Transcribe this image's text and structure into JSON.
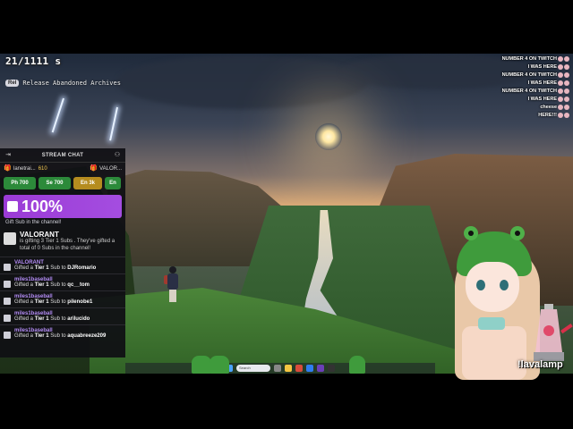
{
  "overlay": {
    "sub_count": "21/1111 s",
    "release_badge": "Rel",
    "release_text": "Release Abandoned Archives"
  },
  "chat": {
    "title": "STREAM CHAT",
    "hype_user": "lanetrai...",
    "hype_count": "610",
    "hype_game": "VALOR...",
    "predictions": [
      "Ph 700",
      "Se 700",
      "En 3k",
      "En"
    ],
    "hype_percent": "100%",
    "hype_note": "Gift Sub in the channel!",
    "gift_main": {
      "name": "VALORANT",
      "text": "is gifting 3 Tier 1 Subs . They've gifted a total of 0 Subs in the channel!"
    },
    "gifts": [
      {
        "user": "VALORANT",
        "prefix": "Gifted a",
        "tier": "Tier 1",
        "mid": "Sub to",
        "recipient": "DJRomario"
      },
      {
        "user": "miles1baseball",
        "prefix": "Gifted a",
        "tier": "Tier 1",
        "mid": "Sub to",
        "recipient": "qc__tom"
      },
      {
        "user": "miles1baseball",
        "prefix": "Gifted a",
        "tier": "Tier 1",
        "mid": "Sub to",
        "recipient": "pilenobe1"
      },
      {
        "user": "miles1baseball",
        "prefix": "Gifted a",
        "tier": "Tier 1",
        "mid": "Sub to",
        "recipient": "arilucido"
      },
      {
        "user": "miles1baseball",
        "prefix": "Gifted a",
        "tier": "Tier 1",
        "mid": "Sub to",
        "recipient": "aquabreeze209"
      }
    ]
  },
  "ticker": [
    "NUMBER 4 ON TWITCH",
    "I WAS HERE",
    "NUMBER 4 ON TWITCH",
    "I WAS HERE",
    "NUMBER 4 ON TWITCH",
    "I WAS HERE",
    "cheese",
    "HERE!!!"
  ],
  "lava_label": "!lavalamp",
  "taskbar": {
    "search_text": "Search"
  },
  "colors": {
    "hype_purple": "#9b3bd6",
    "prediction_green": "#2c8a3a",
    "username_purple": "#b38cf5"
  }
}
